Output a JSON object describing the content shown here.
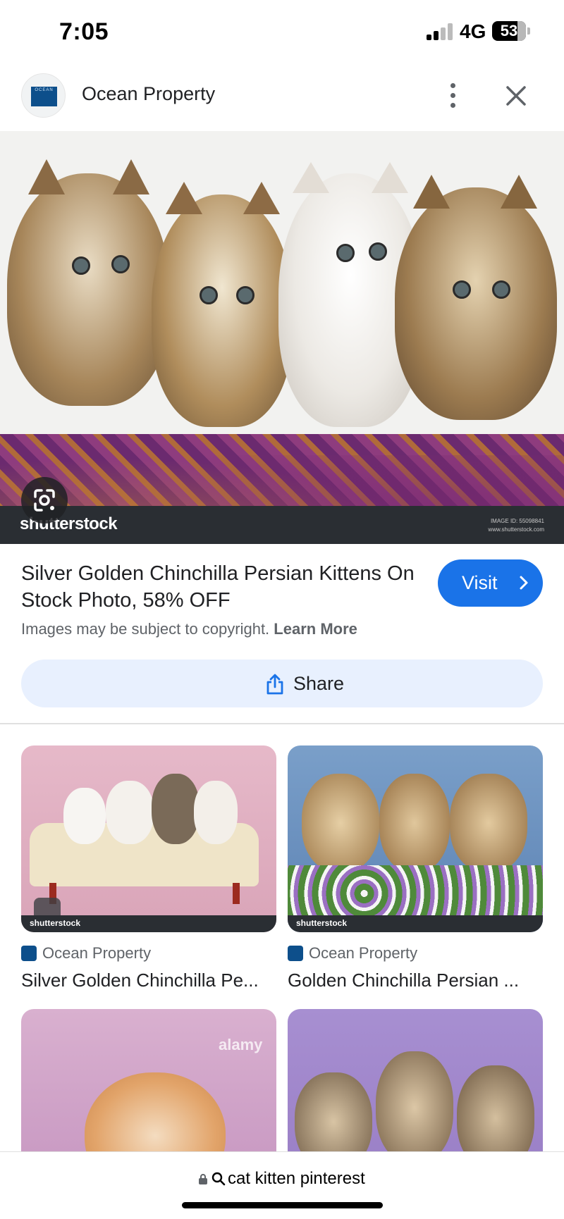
{
  "status_bar": {
    "time": "7:05",
    "network": "4G",
    "battery": "53"
  },
  "header": {
    "site_name": "Ocean Property",
    "logo_text": "OCEAN",
    "more_icon": "more-vert-icon",
    "close_icon": "close-icon"
  },
  "hero": {
    "watermark": "shutterstock",
    "meta_line1": "IMAGE ID: 55098841",
    "meta_line2": "www.shutterstock.com",
    "lens_icon": "google-lens-icon"
  },
  "result": {
    "title": "Silver Golden Chinchilla Persian Kittens On Stock Photo, 58% OFF",
    "visit_label": "Visit",
    "copyright_text": "Images may be subject to copyright.",
    "learn_more": "Learn More",
    "share_label": "Share"
  },
  "related": [
    {
      "source": "Ocean Property",
      "title": "Silver Golden Chinchilla Pe...",
      "watermark": "shutterstock"
    },
    {
      "source": "Ocean Property",
      "title": "Golden Chinchilla Persian ...",
      "watermark": "shutterstock"
    },
    {
      "source": "",
      "title": "",
      "watermark": "alamy"
    },
    {
      "source": "",
      "title": "",
      "watermark": ""
    }
  ],
  "url_bar": {
    "url": "cat kitten pinterest"
  },
  "colors": {
    "accent": "#1a73e8",
    "share_bg": "#e8f0fe",
    "text": "#202124",
    "muted": "#5f6368"
  }
}
